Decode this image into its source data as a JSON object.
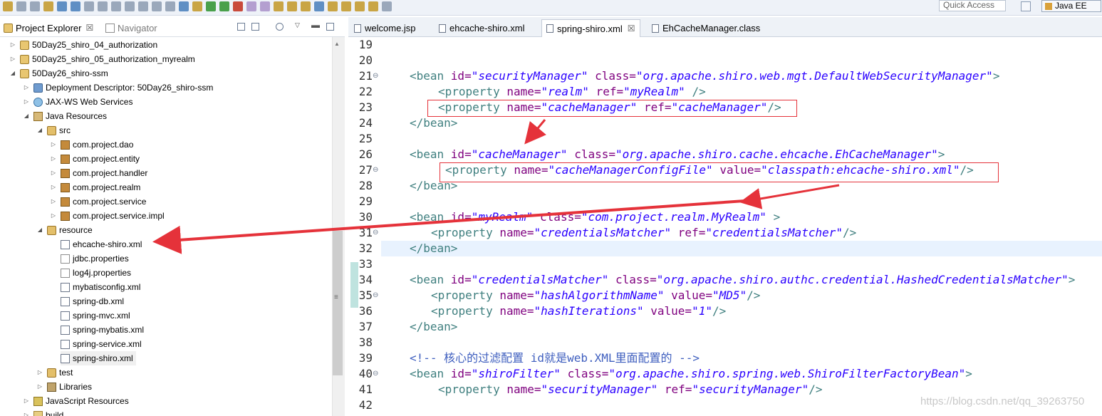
{
  "toolbar": {
    "quick_access_placeholder": "Quick Access",
    "perspective_label": "Java EE"
  },
  "left_panel": {
    "tabs": [
      {
        "label": "Project Explorer",
        "close": "☒"
      },
      {
        "label": "Navigator"
      }
    ],
    "tree": [
      {
        "label": "50Day25_shiro_04_authorization"
      },
      {
        "label": "50Day25_shiro_05_authorization_myrealm"
      },
      {
        "label": "50Day26_shiro-ssm"
      },
      {
        "label": "Deployment Descriptor: 50Day26_shiro-ssm"
      },
      {
        "label": "JAX-WS Web Services"
      },
      {
        "label": "Java Resources"
      },
      {
        "label": "src"
      },
      {
        "label": "com.project.dao"
      },
      {
        "label": "com.project.entity"
      },
      {
        "label": "com.project.handler"
      },
      {
        "label": "com.project.realm"
      },
      {
        "label": "com.project.service"
      },
      {
        "label": "com.project.service.impl"
      },
      {
        "label": "resource"
      },
      {
        "label": "ehcache-shiro.xml"
      },
      {
        "label": "jdbc.properties"
      },
      {
        "label": "log4j.properties"
      },
      {
        "label": "mybatisconfig.xml"
      },
      {
        "label": "spring-db.xml"
      },
      {
        "label": "spring-mvc.xml"
      },
      {
        "label": "spring-mybatis.xml"
      },
      {
        "label": "spring-service.xml"
      },
      {
        "label": "spring-shiro.xml"
      },
      {
        "label": "test"
      },
      {
        "label": "Libraries"
      },
      {
        "label": "JavaScript Resources"
      },
      {
        "label": "build"
      }
    ]
  },
  "editor": {
    "tabs": [
      {
        "label": "welcome.jsp"
      },
      {
        "label": "ehcache-shiro.xml"
      },
      {
        "label": "spring-shiro.xml",
        "close": "☒"
      },
      {
        "label": "EhCacheManager.class"
      }
    ],
    "line_numbers": [
      "19",
      "20",
      "21",
      "22",
      "23",
      "24",
      "25",
      "26",
      "27",
      "28",
      "29",
      "30",
      "31",
      "32",
      "33",
      "34",
      "35",
      "36",
      "37",
      "38",
      "39",
      "40",
      "41",
      "42"
    ],
    "lines": {
      "l21": {
        "t1": "<bean ",
        "a1": "id=",
        "v1": "\"securityManager\"",
        "a2": " class=",
        "v2": "\"org.apache.shiro.web.mgt.DefaultWebSecurityManager\"",
        "t2": ">"
      },
      "l22": {
        "t1": "<property ",
        "a1": "name=",
        "v1": "\"realm\"",
        "a2": " ref=",
        "v2": "\"myRealm\"",
        "t2": " />"
      },
      "l23": {
        "t1": "<property ",
        "a1": "name=",
        "v1": "\"cacheManager\"",
        "a2": " ref=",
        "v2": "\"cacheManager\"",
        "t2": "/>"
      },
      "l24": {
        "t1": "</bean>"
      },
      "l26": {
        "t1": "<bean ",
        "a1": "id=",
        "v1": "\"cacheManager\"",
        "a2": " class=",
        "v2": "\"org.apache.shiro.cache.ehcache.EhCacheManager\"",
        "t2": ">"
      },
      "l27": {
        "t1": "<property ",
        "a1": "name=",
        "v1": "\"cacheManagerConfigFile\"",
        "a2": " value=",
        "v2": "\"classpath:ehcache-shiro.xml\"",
        "t2": "/>"
      },
      "l28": {
        "t1": "</bean>"
      },
      "l30": {
        "t1": "<bean ",
        "a1": "id=",
        "v1": "\"myRealm\"",
        "a2": " class=",
        "v2": "\"com.project.realm.MyRealm\"",
        "t2": " >"
      },
      "l31": {
        "t1": "<property ",
        "a1": "name=",
        "v1": "\"credentialsMatcher\"",
        "a2": " ref=",
        "v2": "\"credentialsMatcher\"",
        "t2": "/>"
      },
      "l32": {
        "t1": "</bean>"
      },
      "l34": {
        "t1": "<bean ",
        "a1": "id=",
        "v1": "\"credentialsMatcher\"",
        "a2": " class=",
        "v2": "\"org.apache.shiro.authc.credential.HashedCredentialsMatcher\"",
        "t2": ">"
      },
      "l35": {
        "t1": "<property ",
        "a1": "name=",
        "v1": "\"hashAlgorithmName\"",
        "a2": " value=",
        "v2": "\"MD5\"",
        "t2": "/>"
      },
      "l36": {
        "t1": "<property ",
        "a1": "name=",
        "v1": "\"hashIterations\"",
        "a2": " value=",
        "v2": "\"1\"",
        "t2": "/>"
      },
      "l37": {
        "t1": "</bean>"
      },
      "l39": {
        "c": "<!-- 核心的过滤配置 id就是web.XML里面配置的 -->"
      },
      "l40": {
        "t1": "<bean ",
        "a1": "id=",
        "v1": "\"shiroFilter\"",
        "a2": " class=",
        "v2": "\"org.apache.shiro.spring.web.ShiroFilterFactoryBean\"",
        "t2": ">"
      },
      "l41": {
        "t1": "<property ",
        "a1": "name=",
        "v1": "\"securityManager\"",
        "a2": " ref=",
        "v2": "\"securityManager\"",
        "t2": "/>"
      }
    }
  },
  "watermark": "https://blog.csdn.net/qq_39263750",
  "colors": {
    "annotation": "#e5323a",
    "tag": "#3f7f7f",
    "attribute": "#7f007f",
    "value": "#2a00ff",
    "comment": "#3f5fbf",
    "current_line": "#e8f2fe"
  }
}
